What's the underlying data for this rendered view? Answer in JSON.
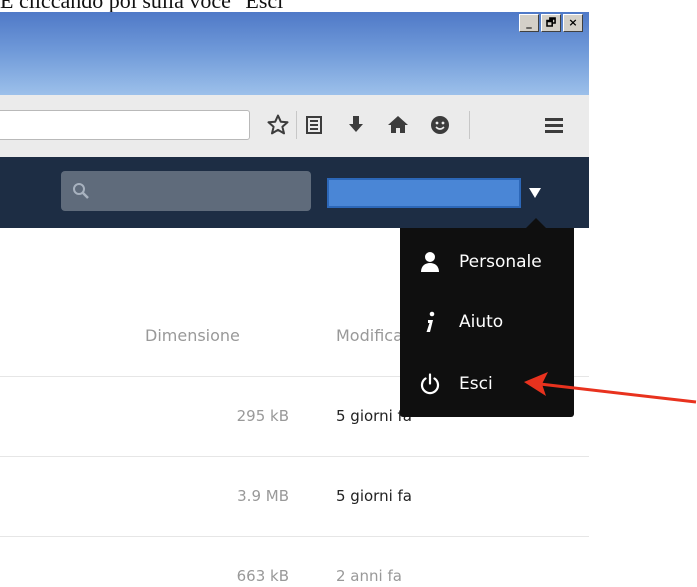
{
  "caption": "E cliccando poi sulla voce \"Esci\"",
  "window_buttons": [
    "_",
    "🗗",
    "×"
  ],
  "columns": {
    "size": "Dimensione",
    "modified": "Modifica"
  },
  "files": [
    {
      "size": "295 kB",
      "modified": "5 giorni fa"
    },
    {
      "size": "3.9 MB",
      "modified": "5 giorni fa"
    },
    {
      "size": "663 kB",
      "modified": "2 anni fa"
    }
  ],
  "user_menu": {
    "items": [
      {
        "label": "Personale",
        "icon": "person-icon"
      },
      {
        "label": "Aiuto",
        "icon": "info-icon"
      },
      {
        "label": "Esci",
        "icon": "power-icon"
      }
    ]
  },
  "colors": {
    "header_bg": "#1d2d44",
    "menu_bg": "#0f0f0f",
    "accent_arrow": "#e8321e",
    "user_box": "#4a86d6"
  }
}
